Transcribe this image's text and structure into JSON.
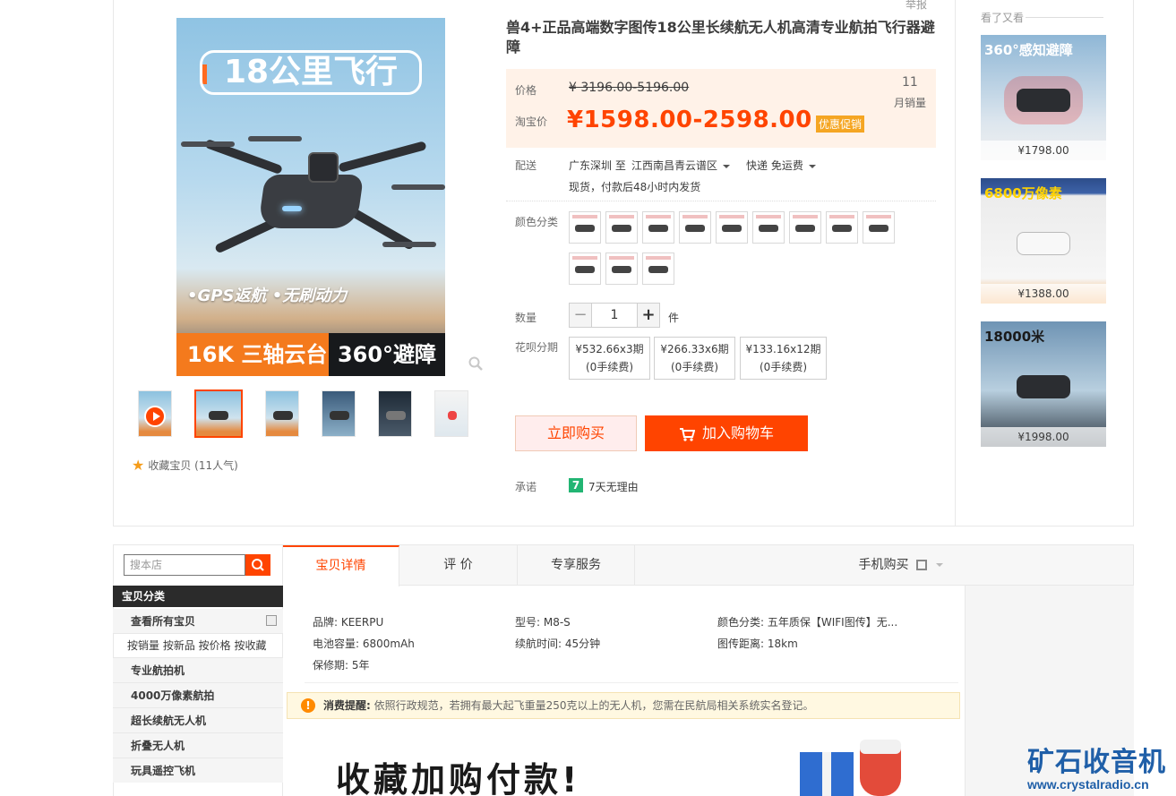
{
  "product": {
    "report_link": "举报",
    "title": "兽4+正品高端数字图传18公里长续航无人机高清专业航拍飞行器避障",
    "main_image": {
      "banner_text": "18公里飞行",
      "features": "•GPS返航  •无刷动力",
      "bottom_left": "16K 三轴云台",
      "bottom_right": "360°避障"
    },
    "favorite": "收藏宝贝 (11人气)",
    "price": {
      "label": "价格",
      "original": "¥ 3196.00-5196.00",
      "taobao_label": "淘宝价",
      "current": "¥1598.00-2598.00",
      "badge": "优惠促销",
      "sales_count": "11",
      "sales_label": "月销量"
    },
    "delivery": {
      "label": "配送",
      "from": "广东深圳 至",
      "to": "江西南昌青云谱区",
      "shipping": "快递 免运费",
      "note": "现货，付款后48小时内发货"
    },
    "color_label": "颜色分类",
    "quantity": {
      "label": "数量",
      "value": "1",
      "unit": "件",
      "minus": "−",
      "plus": "+"
    },
    "installment": {
      "label": "花呗分期",
      "options": [
        {
          "price": "¥532.66x3期",
          "fee": "(0手续费)"
        },
        {
          "price": "¥266.33x6期",
          "fee": "(0手续费)"
        },
        {
          "price": "¥133.16x12期",
          "fee": "(0手续费)"
        }
      ]
    },
    "buy_now": "立即购买",
    "add_cart": "加入购物车",
    "promise": {
      "label": "承诺",
      "icon_text": "7",
      "text": "7天无理由"
    }
  },
  "seen_also": {
    "title": "看了又看",
    "items": [
      {
        "headline": "360°感知避障",
        "price": "¥1798.00"
      },
      {
        "headline": "6800万像素",
        "price": "¥1388.00"
      },
      {
        "headline": "18000米",
        "price": "¥1998.00"
      }
    ]
  },
  "shop": {
    "search_placeholder": "搜本店",
    "category_header": "宝贝分类",
    "all_items": "查看所有宝贝",
    "sort_links": "按销量 按新品 按价格 按收藏",
    "categories": [
      "专业航拍机",
      "4000万像素航拍",
      "超长续航无人机",
      "折叠无人机",
      "玩具遥控飞机"
    ]
  },
  "tabs": {
    "details": "宝贝详情",
    "reviews": "评 价",
    "service": "专享服务",
    "mobile": "手机购买"
  },
  "attributes": {
    "brand": "品牌: KEERPU",
    "model": "型号: M8-S",
    "color": "颜色分类: 五年质保【WIFI图传】无...",
    "battery": "电池容量: 6800mAh",
    "flight_time": "续航时间: 45分钟",
    "range": "图传距离: 18km",
    "warranty": "保修期: 5年"
  },
  "notice": {
    "title": "消费提醒:",
    "text": "依照行政规范，若拥有最大起飞重量250克以上的无人机，您需在民航局相关系统实名登记。"
  },
  "detail_banner": "收藏加购付款!",
  "watermark": {
    "cn": "矿石收音机",
    "url": "www.crystalradio.cn"
  }
}
